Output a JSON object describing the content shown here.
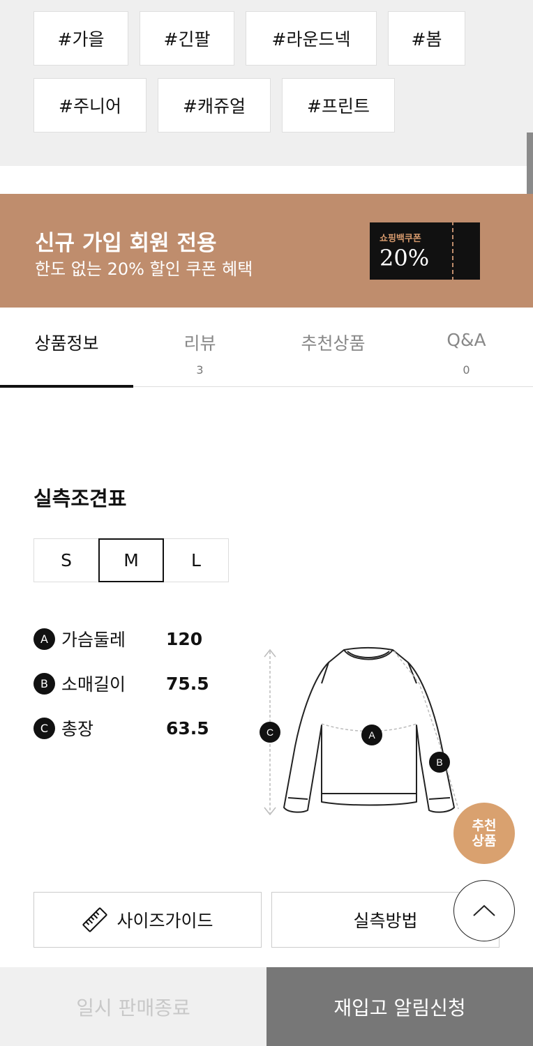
{
  "tags": [
    "#가을",
    "#긴팔",
    "#라운드넥",
    "#봄",
    "#주니어",
    "#캐쥬얼",
    "#프린트"
  ],
  "banner": {
    "title": "신규 가입 회원 전용",
    "subtitle": "한도 없는 20% 할인 쿠폰 혜택",
    "coupon_label": "쇼핑백쿠폰",
    "coupon_value": "20%",
    "background_color": "#bf8d6d"
  },
  "tabs": [
    {
      "label": "상품정보",
      "count": "",
      "active": true
    },
    {
      "label": "리뷰",
      "count": "3",
      "active": false
    },
    {
      "label": "추천상품",
      "count": "",
      "active": false
    },
    {
      "label": "Q&A",
      "count": "0",
      "active": false
    }
  ],
  "size_chart": {
    "title": "실측조견표",
    "sizes": [
      "S",
      "M",
      "L"
    ],
    "selected_size": "M",
    "measurements": [
      {
        "marker": "A",
        "name": "가슴둘레",
        "value": "120"
      },
      {
        "marker": "B",
        "name": "소매길이",
        "value": "75.5"
      },
      {
        "marker": "C",
        "name": "총장",
        "value": "63.5"
      }
    ]
  },
  "buttons": {
    "size_guide": "사이즈가이드",
    "measure_method": "실측방법"
  },
  "floating": {
    "recommend_line1": "추천",
    "recommend_line2": "상품",
    "recommend_color": "#d9a16f"
  },
  "bottom_bar": {
    "left_label": "일시 판매종료",
    "right_label": "재입고 알림신청"
  }
}
